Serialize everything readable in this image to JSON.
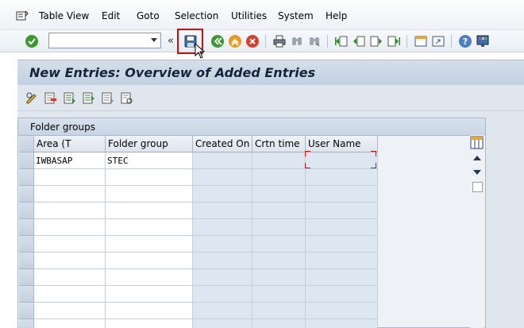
{
  "menu": {
    "items": [
      "Table View",
      "Edit",
      "Goto",
      "Selection",
      "Utilities",
      "System",
      "Help"
    ]
  },
  "toolbar": {
    "command_field_value": "",
    "icons": [
      "enter-icon",
      "save-icon",
      "back-icon",
      "exit-icon",
      "cancel-icon",
      "print-icon",
      "find-icon",
      "find-next-icon",
      "first-page-icon",
      "previous-page-icon",
      "next-page-icon",
      "last-page-icon",
      "create-session-icon",
      "shortcut-icon",
      "help-icon",
      "customize-layout-icon"
    ]
  },
  "screen": {
    "title": "New Entries: Overview of Added Entries"
  },
  "table": {
    "caption": "Folder groups",
    "columns": [
      "Area (T",
      "Folder group",
      "Created On",
      "Crtn time",
      "User Name"
    ],
    "rows": [
      [
        "IWBASAP",
        "STEC",
        "",
        "",
        ""
      ],
      [
        "",
        "",
        "",
        "",
        ""
      ],
      [
        "",
        "",
        "",
        "",
        ""
      ],
      [
        "",
        "",
        "",
        "",
        ""
      ],
      [
        "",
        "",
        "",
        "",
        ""
      ],
      [
        "",
        "",
        "",
        "",
        ""
      ],
      [
        "",
        "",
        "",
        "",
        ""
      ],
      [
        "",
        "",
        "",
        "",
        ""
      ],
      [
        "",
        "",
        "",
        "",
        ""
      ],
      [
        "",
        "",
        "",
        "",
        ""
      ],
      [
        "",
        "",
        "",
        "",
        ""
      ]
    ]
  },
  "colors": {
    "highlight": "#d01010",
    "title_bg": "#c8d5e4",
    "readonly_cell": "#dce7f2"
  }
}
